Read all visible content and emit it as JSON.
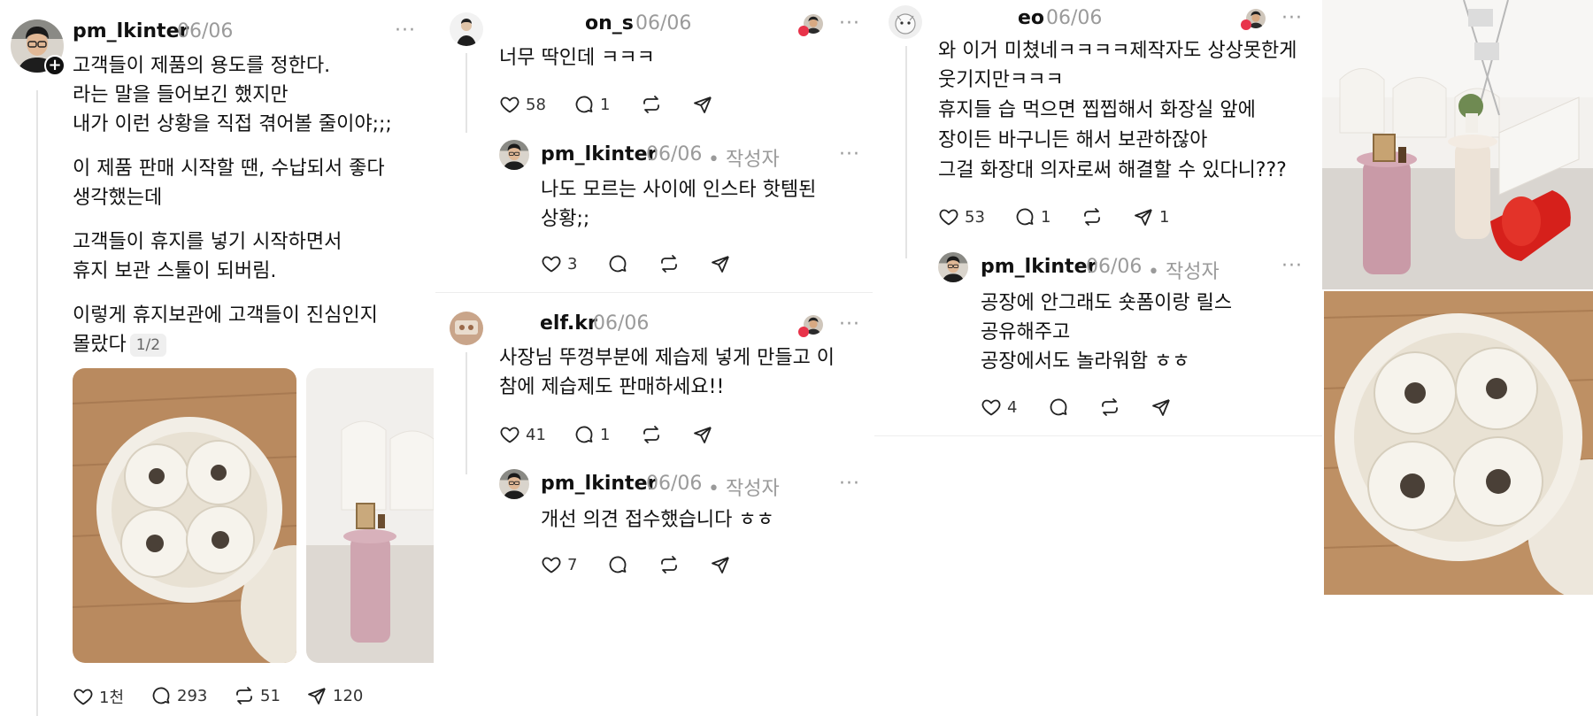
{
  "post": {
    "author": "pm_lkinter",
    "date": "06/06",
    "lines": [
      "고객들이 제품의 용도를 정한다.",
      "라는 말을 들어보긴 했지만",
      "내가 이런 상황을 직접 겪어볼 줄이야;;;",
      "이 제품 판매 시작할 땐, 수납되서 좋다",
      "생각했는데",
      "고객들이 휴지를 넣기 시작하면서",
      "휴지 보관 스툴이 되버림.",
      "이렇게 휴지보관에 고객들이 진심인지",
      "몰랐다"
    ],
    "page_badge": "1/2",
    "actions": {
      "likes": "1천",
      "comments": "293",
      "reposts": "51",
      "shares": "120"
    }
  },
  "column2": {
    "c1": {
      "author": "on_s",
      "date": "06/06",
      "text": "너무 딱인데 ㅋㅋㅋ",
      "likes": "58",
      "comments": "1"
    },
    "r1": {
      "author": "pm_lkinter",
      "date": "06/06",
      "tag": "• 작성자",
      "lines": [
        "나도 모르는 사이에 인스타 핫템된",
        "상황;;"
      ],
      "likes": "3"
    },
    "c2": {
      "author": "elf.kr",
      "date": "06/06",
      "lines": [
        "사장님 뚜껑부분에 제습제 넣게 만들고 이",
        "참에 제습제도 판매하세요!!"
      ],
      "likes": "41",
      "comments": "1"
    },
    "r2": {
      "author": "pm_lkinter",
      "date": "06/06",
      "tag": "• 작성자",
      "text": "개선 의견 접수했습니다 ㅎㅎ",
      "likes": "7"
    }
  },
  "column3": {
    "c1": {
      "author": "eo",
      "date": "06/06",
      "lines": [
        "와 이거 미쳤네ㅋㅋㅋㅋ제작자도 상상못한게",
        "웃기지만ㅋㅋㅋ",
        "휴지들 습 먹으면 찝찝해서 화장실 앞에",
        "장이든 바구니든 해서 보관하잖아",
        "그걸 화장대 의자로써 해결할 수 있다니???"
      ],
      "likes": "53",
      "comments": "1",
      "shares": "1"
    },
    "r1": {
      "author": "pm_lkinter",
      "date": "06/06",
      "tag": "• 작성자",
      "lines": [
        "공장에 안그래도 숏폼이랑 릴스",
        "공유해주고",
        "공장에서도 놀라워함 ㅎㅎ"
      ],
      "likes": "4"
    }
  },
  "colors": {
    "muted": "#9a9a9a",
    "reaction_red": "#e8334a",
    "divider": "#ededed"
  },
  "icons": [
    "heart-icon",
    "comment-icon",
    "repost-icon",
    "share-icon",
    "more-icon",
    "follow-plus-icon"
  ]
}
